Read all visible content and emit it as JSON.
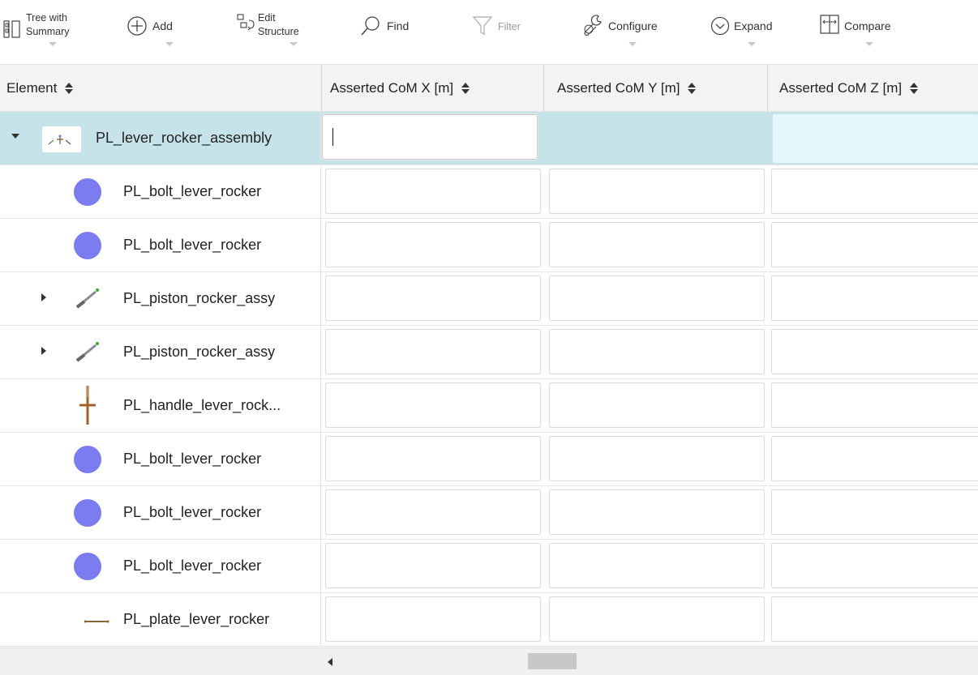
{
  "toolbar": {
    "tree_summary": {
      "line1": "Tree with",
      "line2": "Summary"
    },
    "add": "Add",
    "edit_structure": {
      "line1": "Edit",
      "line2": "Structure"
    },
    "find": "Find",
    "filter": "Filter",
    "configure": "Configure",
    "expand": "Expand",
    "compare": "Compare"
  },
  "columns": {
    "element": "Element",
    "com_x": "Asserted CoM X [m]",
    "com_y": "Asserted CoM Y [m]",
    "com_z": "Asserted CoM Z [m]"
  },
  "rows": [
    {
      "name": "PL_lever_rocker_assembly",
      "icon": "assembly-icon",
      "expander": "expanded",
      "com_x": "",
      "com_y": "",
      "com_z": ""
    },
    {
      "name": "PL_bolt_lever_rocker",
      "icon": "bolt-icon",
      "expander": "none",
      "com_x": "",
      "com_y": "",
      "com_z": ""
    },
    {
      "name": "PL_bolt_lever_rocker",
      "icon": "bolt-icon",
      "expander": "none",
      "com_x": "",
      "com_y": "",
      "com_z": ""
    },
    {
      "name": "PL_piston_rocker_assy",
      "icon": "piston-assembly-icon",
      "expander": "collapsed",
      "com_x": "",
      "com_y": "",
      "com_z": ""
    },
    {
      "name": "PL_piston_rocker_assy",
      "icon": "piston-assembly-icon",
      "expander": "collapsed",
      "com_x": "",
      "com_y": "",
      "com_z": ""
    },
    {
      "name": "PL_handle_lever_rock...",
      "icon": "handle-icon",
      "expander": "none",
      "com_x": "",
      "com_y": "",
      "com_z": ""
    },
    {
      "name": "PL_bolt_lever_rocker",
      "icon": "bolt-icon",
      "expander": "none",
      "com_x": "",
      "com_y": "",
      "com_z": ""
    },
    {
      "name": "PL_bolt_lever_rocker",
      "icon": "bolt-icon",
      "expander": "none",
      "com_x": "",
      "com_y": "",
      "com_z": ""
    },
    {
      "name": "PL_bolt_lever_rocker",
      "icon": "bolt-icon",
      "expander": "none",
      "com_x": "",
      "com_y": "",
      "com_z": ""
    },
    {
      "name": "PL_plate_lever_rocker",
      "icon": "plate-icon",
      "expander": "none",
      "com_x": "",
      "com_y": "",
      "com_z": ""
    }
  ],
  "colors": {
    "selected_row": "#c7e3ea",
    "selected_tint": "#e2f8fc",
    "bolt": "#7b7cf0",
    "handle": "#a0622d"
  }
}
